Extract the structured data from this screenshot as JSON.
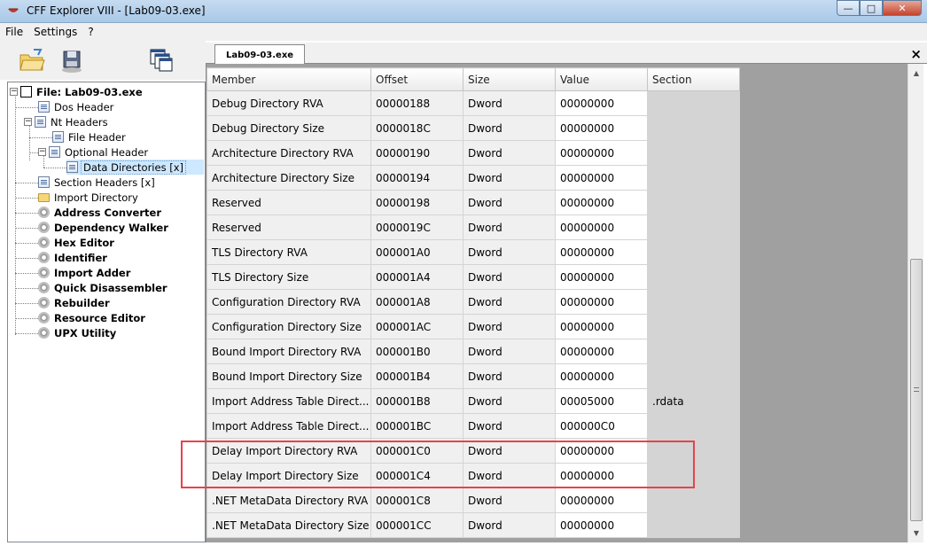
{
  "window": {
    "title": "CFF Explorer VIII - [Lab09-03.exe]",
    "min_glyph": "—",
    "max_glyph": "□",
    "close_glyph": "✕"
  },
  "menu": [
    "File",
    "Settings",
    "?"
  ],
  "toolbar": {
    "buttons": [
      "open-folder-icon",
      "save-disk-icon",
      "windows-cascade-icon"
    ]
  },
  "tree": {
    "root": "File: Lab09-03.exe",
    "items": [
      {
        "label": "Dos Header",
        "icon": "doc-icon"
      },
      {
        "label": "Nt Headers",
        "icon": "doc-icon"
      },
      {
        "label": "File Header",
        "icon": "doc-icon"
      },
      {
        "label": "Optional Header",
        "icon": "doc-icon"
      },
      {
        "label": "Data Directories [x]",
        "icon": "doc-icon"
      },
      {
        "label": "Section Headers [x]",
        "icon": "doc-icon"
      },
      {
        "label": "Import Directory",
        "icon": "folder-icon"
      },
      {
        "label": "Address Converter",
        "icon": "gear-icon"
      },
      {
        "label": "Dependency Walker",
        "icon": "gear-icon"
      },
      {
        "label": "Hex Editor",
        "icon": "gear-icon"
      },
      {
        "label": "Identifier",
        "icon": "gear-icon"
      },
      {
        "label": "Import Adder",
        "icon": "gear-icon"
      },
      {
        "label": "Quick Disassembler",
        "icon": "gear-icon"
      },
      {
        "label": "Rebuilder",
        "icon": "gear-icon"
      },
      {
        "label": "Resource Editor",
        "icon": "gear-icon"
      },
      {
        "label": "UPX Utility",
        "icon": "gear-icon"
      }
    ],
    "selected": "Data Directories [x]"
  },
  "tab": {
    "label": "Lab09-03.exe",
    "close_glyph": "×"
  },
  "grid": {
    "columns": [
      "Member",
      "Offset",
      "Size",
      "Value",
      "Section"
    ],
    "rows": [
      [
        "Debug Directory RVA",
        "00000188",
        "Dword",
        "00000000",
        ""
      ],
      [
        "Debug Directory Size",
        "0000018C",
        "Dword",
        "00000000",
        ""
      ],
      [
        "Architecture Directory RVA",
        "00000190",
        "Dword",
        "00000000",
        ""
      ],
      [
        "Architecture Directory Size",
        "00000194",
        "Dword",
        "00000000",
        ""
      ],
      [
        "Reserved",
        "00000198",
        "Dword",
        "00000000",
        ""
      ],
      [
        "Reserved",
        "0000019C",
        "Dword",
        "00000000",
        ""
      ],
      [
        "TLS Directory RVA",
        "000001A0",
        "Dword",
        "00000000",
        ""
      ],
      [
        "TLS Directory Size",
        "000001A4",
        "Dword",
        "00000000",
        ""
      ],
      [
        "Configuration Directory RVA",
        "000001A8",
        "Dword",
        "00000000",
        ""
      ],
      [
        "Configuration Directory Size",
        "000001AC",
        "Dword",
        "00000000",
        ""
      ],
      [
        "Bound Import Directory RVA",
        "000001B0",
        "Dword",
        "00000000",
        ""
      ],
      [
        "Bound Import Directory Size",
        "000001B4",
        "Dword",
        "00000000",
        ""
      ],
      [
        "Import Address Table Direct...",
        "000001B8",
        "Dword",
        "00005000",
        ".rdata"
      ],
      [
        "Import Address Table Direct...",
        "000001BC",
        "Dword",
        "000000C0",
        ""
      ],
      [
        "Delay Import Directory RVA",
        "000001C0",
        "Dword",
        "00000000",
        ""
      ],
      [
        "Delay Import Directory Size",
        "000001C4",
        "Dword",
        "00000000",
        ""
      ],
      [
        ".NET MetaData Directory RVA",
        "000001C8",
        "Dword",
        "00000000",
        ""
      ],
      [
        ".NET MetaData Directory Size",
        "000001CC",
        "Dword",
        "00000000",
        ""
      ]
    ]
  },
  "scrollbar": {
    "up_glyph": "▲",
    "down_glyph": "▼"
  },
  "colors": {
    "highlight_box": "#e8424a",
    "selected_tree": "#cde8ff"
  }
}
